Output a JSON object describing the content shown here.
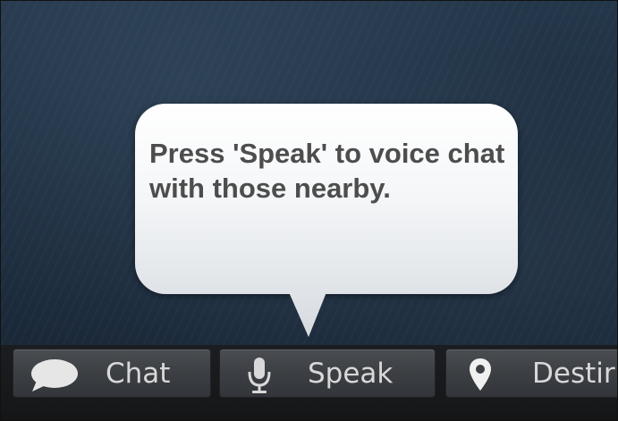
{
  "tooltip": {
    "text": "Press 'Speak' to voice chat with those nearby."
  },
  "toolbar": {
    "buttons": [
      {
        "label": "Chat",
        "icon": "speech-bubble-icon"
      },
      {
        "label": "Speak",
        "icon": "microphone-icon"
      },
      {
        "label": "Destir",
        "icon": "map-pin-icon"
      }
    ]
  },
  "colors": {
    "tooltip_text": "#4d4d4d",
    "button_text": "#d8d8d8",
    "toolbar_bg": "#1b1d20",
    "scene_bg": "#1d2d3e"
  }
}
